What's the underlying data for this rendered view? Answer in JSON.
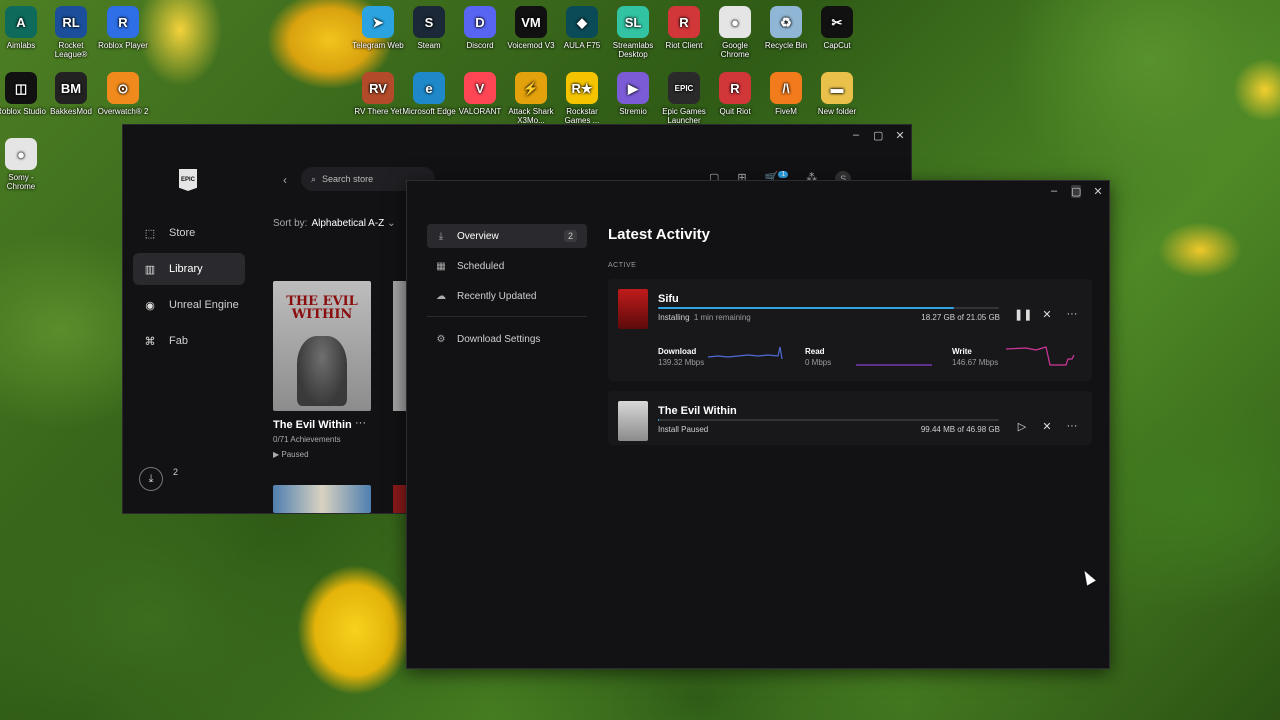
{
  "desktop_icons": [
    {
      "label": "Aimlabs",
      "icon": "aimlabs-icon",
      "color": "#0e6b5c",
      "glyph": "A"
    },
    {
      "label": "Rocket League®",
      "icon": "rocket-league-icon",
      "color": "#1b4f9b",
      "glyph": "RL"
    },
    {
      "label": "Roblox Player",
      "icon": "roblox-icon",
      "color": "#2e6ee6",
      "glyph": "R"
    },
    {
      "label": "Telegram Web",
      "icon": "telegram-icon",
      "color": "#2aa3e0",
      "glyph": "➤"
    },
    {
      "label": "Steam",
      "icon": "steam-icon",
      "color": "#1b2838",
      "glyph": "S"
    },
    {
      "label": "Discord",
      "icon": "discord-icon",
      "color": "#5865f2",
      "glyph": "D"
    },
    {
      "label": "Voicemod V3",
      "icon": "voicemod-icon",
      "color": "#111111",
      "glyph": "VM"
    },
    {
      "label": "AULA F75",
      "icon": "aula-icon",
      "color": "#0b4a57",
      "glyph": "◆"
    },
    {
      "label": "Streamlabs Desktop",
      "icon": "streamlabs-icon",
      "color": "#31c3a2",
      "glyph": "SL"
    },
    {
      "label": "Riot Client",
      "icon": "riot-client-icon",
      "color": "#d13639",
      "glyph": "R"
    },
    {
      "label": "Google Chrome",
      "icon": "chrome-icon",
      "color": "#e5e5e5",
      "glyph": "●"
    },
    {
      "label": "Recycle Bin",
      "icon": "recycle-bin-icon",
      "color": "#8fb6d4",
      "glyph": "♻"
    },
    {
      "label": "CapCut",
      "icon": "capcut-icon",
      "color": "#111111",
      "glyph": "✂"
    },
    {
      "label": "Roblox Studio",
      "icon": "roblox-studio-icon",
      "color": "#111111",
      "glyph": "◫"
    },
    {
      "label": "BakkesMod",
      "icon": "bakkesmod-icon",
      "color": "#222222",
      "glyph": "BM"
    },
    {
      "label": "Overwatch® 2",
      "icon": "overwatch-icon",
      "color": "#f08a1c",
      "glyph": "⊙"
    },
    {
      "label": "RV There Yet",
      "icon": "rv-there-yet-icon",
      "color": "#b34b2a",
      "glyph": "RV"
    },
    {
      "label": "Microsoft Edge",
      "icon": "edge-icon",
      "color": "#1e88c8",
      "glyph": "e"
    },
    {
      "label": "VALORANT",
      "icon": "valorant-icon",
      "color": "#ff4655",
      "glyph": "V"
    },
    {
      "label": "Attack Shark X3Mo...",
      "icon": "attack-shark-icon",
      "color": "#e3a10c",
      "glyph": "⚡"
    },
    {
      "label": "Rockstar Games ...",
      "icon": "rockstar-icon",
      "color": "#f5c400",
      "glyph": "R★"
    },
    {
      "label": "Stremio",
      "icon": "stremio-icon",
      "color": "#7b5bd6",
      "glyph": "▶"
    },
    {
      "label": "Epic Games Launcher",
      "icon": "epic-games-icon",
      "color": "#2a2a2a",
      "glyph": "EPIC"
    },
    {
      "label": "Quit Riot",
      "icon": "quit-riot-icon",
      "color": "#d13639",
      "glyph": "R"
    },
    {
      "label": "FiveM",
      "icon": "fivem-icon",
      "color": "#f27b1c",
      "glyph": "/\\"
    },
    {
      "label": "New folder",
      "icon": "folder-icon",
      "color": "#e8c04a",
      "glyph": "▬"
    },
    {
      "label": "Somy - Chrome",
      "icon": "chrome-icon",
      "color": "#e5e5e5",
      "glyph": "●"
    }
  ],
  "epic_window": {
    "logo_text": "EPIC",
    "nav": [
      {
        "label": "Store",
        "icon": "tag-icon"
      },
      {
        "label": "Library",
        "icon": "library-icon"
      },
      {
        "label": "Unreal Engine",
        "icon": "unreal-icon"
      },
      {
        "label": "Fab",
        "icon": "fab-icon"
      }
    ],
    "active_nav": "Library",
    "search_placeholder": "Search store",
    "sort_label": "Sort by:",
    "sort_value": "Alphabetical A-Z",
    "downloads_count": "2",
    "cart_count": "1",
    "avatar_letter": "S",
    "library_game": {
      "name": "The Evil Within",
      "cover_title": "THE EVIL WITHIN",
      "achievements": "0/71 Achievements",
      "status": "Paused"
    }
  },
  "downloads_window": {
    "nav": [
      {
        "label": "Overview",
        "badge": "2",
        "icon": "download-icon"
      },
      {
        "label": "Scheduled",
        "icon": "calendar-icon"
      },
      {
        "label": "Recently Updated",
        "icon": "cloud-icon"
      }
    ],
    "settings_label": "Download Settings",
    "title": "Latest Activity",
    "section_label": "ACTIVE",
    "items": [
      {
        "name": "Sifu",
        "status": "Installing",
        "remaining": "1 min remaining",
        "size": "18.27 GB of 21.05 GB",
        "progress": 0.868,
        "stats": [
          {
            "label": "Download",
            "value": "139.32 Mbps"
          },
          {
            "label": "Read",
            "value": "0 Mbps"
          },
          {
            "label": "Write",
            "value": "146.67 Mbps"
          }
        ]
      },
      {
        "name": "The Evil Within",
        "status": "Install Paused",
        "size": "99.44 MB of 46.98 GB",
        "progress": 0.002
      }
    ]
  },
  "colors": {
    "accent_blue": "#2fa3e6",
    "write_graph": "#d1379c",
    "read_graph": "#8a3fd1",
    "download_graph": "#4f6bd6"
  }
}
